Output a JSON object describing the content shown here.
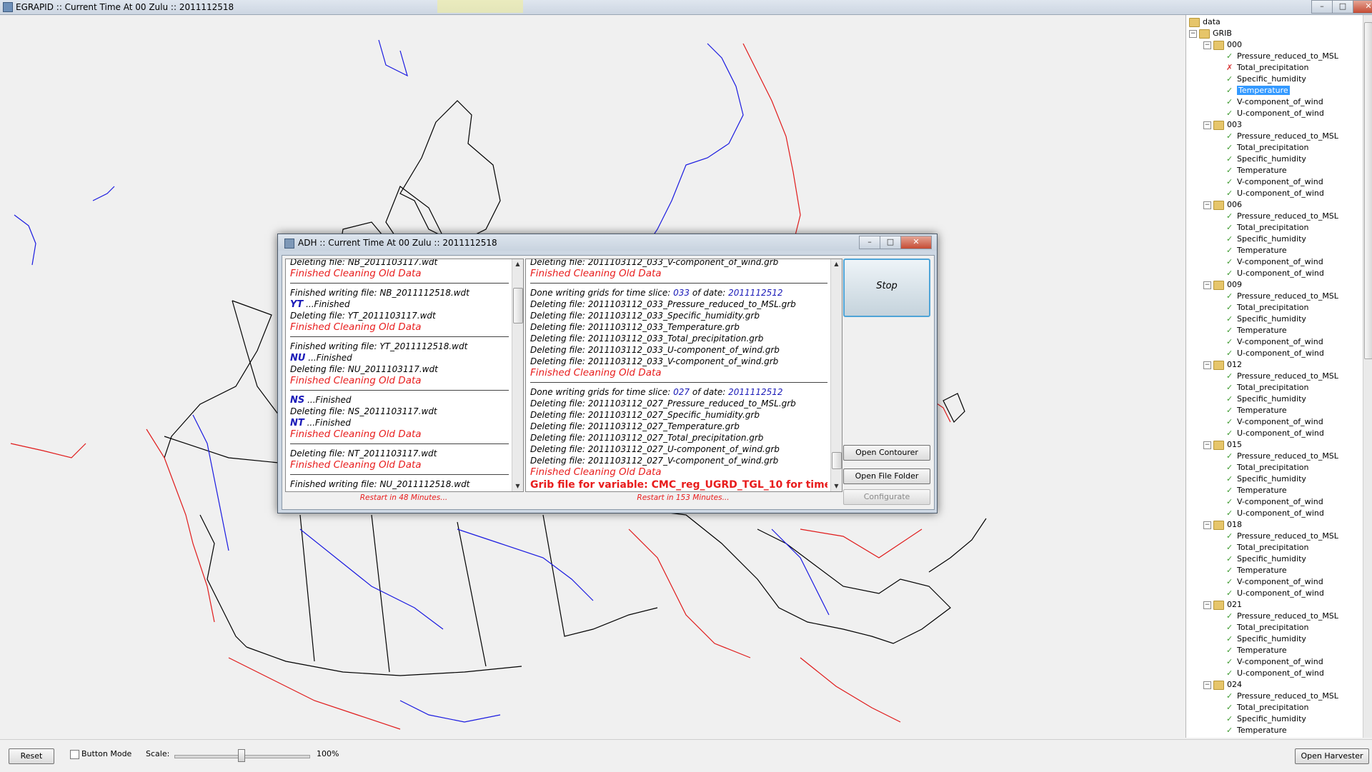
{
  "window": {
    "title": "EGRAPID :: Current Time At 00 Zulu :: 2011112518",
    "minimize": "–",
    "maximize": "□",
    "close": "✕"
  },
  "tree": {
    "root": "data",
    "grib": "GRIB",
    "selected": "Temperature",
    "groups": [
      {
        "name": "000",
        "items": [
          "Pressure_reduced_to_MSL",
          "Total_precipitation",
          "Specific_humidity",
          "Temperature",
          "V-component_of_wind",
          "U-component_of_wind"
        ],
        "status": [
          "ok",
          "error",
          "ok",
          "ok",
          "ok",
          "ok"
        ]
      },
      {
        "name": "003",
        "items": [
          "Pressure_reduced_to_MSL",
          "Total_precipitation",
          "Specific_humidity",
          "Temperature",
          "V-component_of_wind",
          "U-component_of_wind"
        ],
        "status": [
          "ok",
          "ok",
          "ok",
          "ok",
          "ok",
          "ok"
        ]
      },
      {
        "name": "006",
        "items": [
          "Pressure_reduced_to_MSL",
          "Total_precipitation",
          "Specific_humidity",
          "Temperature",
          "V-component_of_wind",
          "U-component_of_wind"
        ],
        "status": [
          "ok",
          "ok",
          "ok",
          "ok",
          "ok",
          "ok"
        ]
      },
      {
        "name": "009",
        "items": [
          "Pressure_reduced_to_MSL",
          "Total_precipitation",
          "Specific_humidity",
          "Temperature",
          "V-component_of_wind",
          "U-component_of_wind"
        ],
        "status": [
          "ok",
          "ok",
          "ok",
          "ok",
          "ok",
          "ok"
        ]
      },
      {
        "name": "012",
        "items": [
          "Pressure_reduced_to_MSL",
          "Total_precipitation",
          "Specific_humidity",
          "Temperature",
          "V-component_of_wind",
          "U-component_of_wind"
        ],
        "status": [
          "ok",
          "ok",
          "ok",
          "ok",
          "ok",
          "ok"
        ]
      },
      {
        "name": "015",
        "items": [
          "Pressure_reduced_to_MSL",
          "Total_precipitation",
          "Specific_humidity",
          "Temperature",
          "V-component_of_wind",
          "U-component_of_wind"
        ],
        "status": [
          "ok",
          "ok",
          "ok",
          "ok",
          "ok",
          "ok"
        ]
      },
      {
        "name": "018",
        "items": [
          "Pressure_reduced_to_MSL",
          "Total_precipitation",
          "Specific_humidity",
          "Temperature",
          "V-component_of_wind",
          "U-component_of_wind"
        ],
        "status": [
          "ok",
          "ok",
          "ok",
          "ok",
          "ok",
          "ok"
        ]
      },
      {
        "name": "021",
        "items": [
          "Pressure_reduced_to_MSL",
          "Total_precipitation",
          "Specific_humidity",
          "Temperature",
          "V-component_of_wind",
          "U-component_of_wind"
        ],
        "status": [
          "ok",
          "ok",
          "ok",
          "ok",
          "ok",
          "ok"
        ]
      },
      {
        "name": "024",
        "items": [
          "Pressure_reduced_to_MSL",
          "Total_precipitation",
          "Specific_humidity",
          "Temperature"
        ],
        "status": [
          "ok",
          "ok",
          "ok",
          "ok"
        ]
      }
    ]
  },
  "bottom": {
    "reset": "Reset",
    "button_mode": "Button Mode",
    "scale_label": "Scale:",
    "scale_value": "100%",
    "scale_fraction": 0.5,
    "open_harvester": "Open Harvester"
  },
  "dialog": {
    "title": "ADH :: Current Time At 00 Zulu :: 2011112518",
    "left_restart": "Restart in 48 Minutes...",
    "right_restart": "Restart in 153 Minutes...",
    "stop": "Stop",
    "open_contourer": "Open Contourer",
    "open_file_folder": "Open File Folder",
    "configurate": "Configurate",
    "left_log": [
      {
        "t": "plain",
        "text": "Deleting file: NB_2011103117.wdt"
      },
      {
        "t": "red",
        "text": "Finished Cleaning Old Data"
      },
      {
        "t": "sep"
      },
      {
        "t": "plain",
        "text": "Finished writing file: NB_2011112518.wdt"
      },
      {
        "t": "prov",
        "code": "YT",
        "text": " ...Finished"
      },
      {
        "t": "plain",
        "text": "Deleting file: YT_2011103117.wdt"
      },
      {
        "t": "red",
        "text": "Finished Cleaning Old Data"
      },
      {
        "t": "sep"
      },
      {
        "t": "plain",
        "text": "Finished writing file: YT_2011112518.wdt"
      },
      {
        "t": "prov",
        "code": "NU",
        "text": " ...Finished"
      },
      {
        "t": "plain",
        "text": "Deleting file: NU_2011103117.wdt"
      },
      {
        "t": "red",
        "text": "Finished Cleaning Old Data"
      },
      {
        "t": "sep"
      },
      {
        "t": "prov",
        "code": "NS",
        "text": " ...Finished"
      },
      {
        "t": "plain",
        "text": "Deleting file: NS_2011103117.wdt"
      },
      {
        "t": "prov",
        "code": "NT",
        "text": " ...Finished"
      },
      {
        "t": "red",
        "text": "Finished Cleaning Old Data"
      },
      {
        "t": "sep"
      },
      {
        "t": "plain",
        "text": "Deleting file: NT_2011103117.wdt"
      },
      {
        "t": "red",
        "text": "Finished Cleaning Old Data"
      },
      {
        "t": "sep"
      },
      {
        "t": "plain",
        "text": "Finished writing file: NU_2011112518.wdt"
      }
    ],
    "right_log": [
      {
        "t": "plain",
        "text": "Deleting file: 2011103112_033_V-component_of_wind.grb"
      },
      {
        "t": "red",
        "text": "Finished Cleaning Old Data"
      },
      {
        "t": "sep"
      },
      {
        "t": "slice",
        "pre": "Done writing grids for time slice: ",
        "slice": "033",
        "mid": " of date: ",
        "date": "2011112512"
      },
      {
        "t": "plain",
        "text": "Deleting file: 2011103112_033_Pressure_reduced_to_MSL.grb"
      },
      {
        "t": "plain",
        "text": "Deleting file: 2011103112_033_Specific_humidity.grb"
      },
      {
        "t": "plain",
        "text": "Deleting file: 2011103112_033_Temperature.grb"
      },
      {
        "t": "plain",
        "text": "Deleting file: 2011103112_033_Total_precipitation.grb"
      },
      {
        "t": "plain",
        "text": "Deleting file: 2011103112_033_U-component_of_wind.grb"
      },
      {
        "t": "plain",
        "text": "Deleting file: 2011103112_033_V-component_of_wind.grb"
      },
      {
        "t": "red",
        "text": "Finished Cleaning Old Data"
      },
      {
        "t": "sep"
      },
      {
        "t": "slice",
        "pre": "Done writing grids for time slice: ",
        "slice": "027",
        "mid": " of date: ",
        "date": "2011112512"
      },
      {
        "t": "plain",
        "text": "Deleting file: 2011103112_027_Pressure_reduced_to_MSL.grb"
      },
      {
        "t": "plain",
        "text": "Deleting file: 2011103112_027_Specific_humidity.grb"
      },
      {
        "t": "plain",
        "text": "Deleting file: 2011103112_027_Temperature.grb"
      },
      {
        "t": "plain",
        "text": "Deleting file: 2011103112_027_Total_precipitation.grb"
      },
      {
        "t": "plain",
        "text": "Deleting file: 2011103112_027_U-component_of_wind.grb"
      },
      {
        "t": "plain",
        "text": "Deleting file: 2011103112_027_V-component_of_wind.grb"
      },
      {
        "t": "red",
        "text": "Finished Cleaning Old Data"
      },
      {
        "t": "bigred",
        "text": "Grib file for variable: CMC_reg_UGRD_TGL_10 for time"
      }
    ]
  },
  "colors": {
    "accent_red": "#e81d1d",
    "accent_blue": "#1a1ab8",
    "check_green": "#3d9a2f",
    "selection": "#3399ff"
  }
}
